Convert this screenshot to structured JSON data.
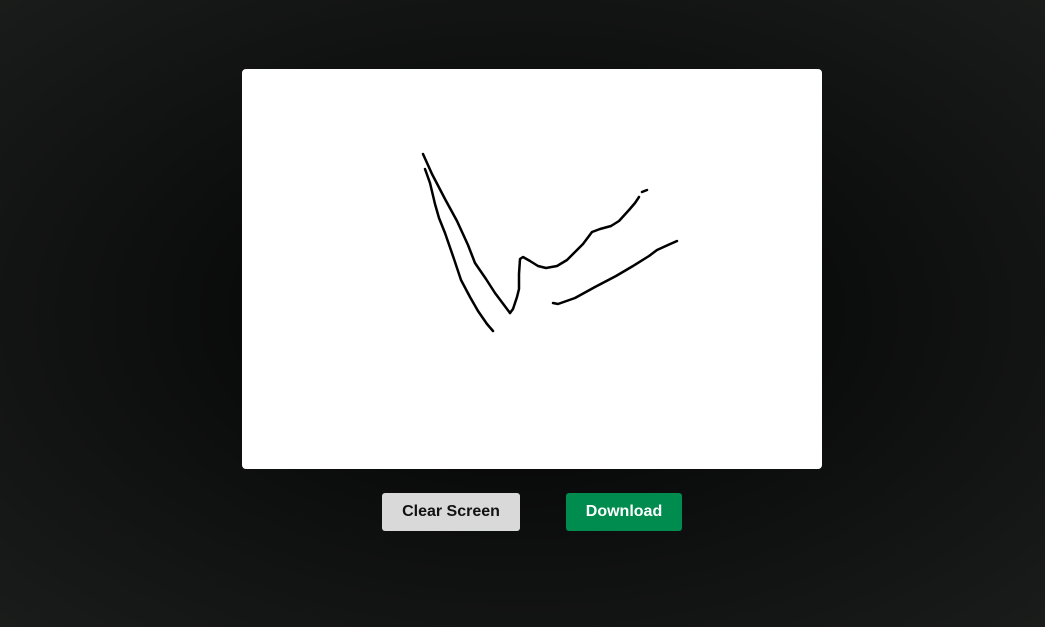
{
  "drawing_canvas": {
    "background": "#ffffff",
    "stroke_color": "#000000"
  },
  "buttons": {
    "clear_label": "Clear Screen",
    "clear_color": "#d9d9d9",
    "download_label": "Download",
    "download_color": "#008c4f"
  }
}
